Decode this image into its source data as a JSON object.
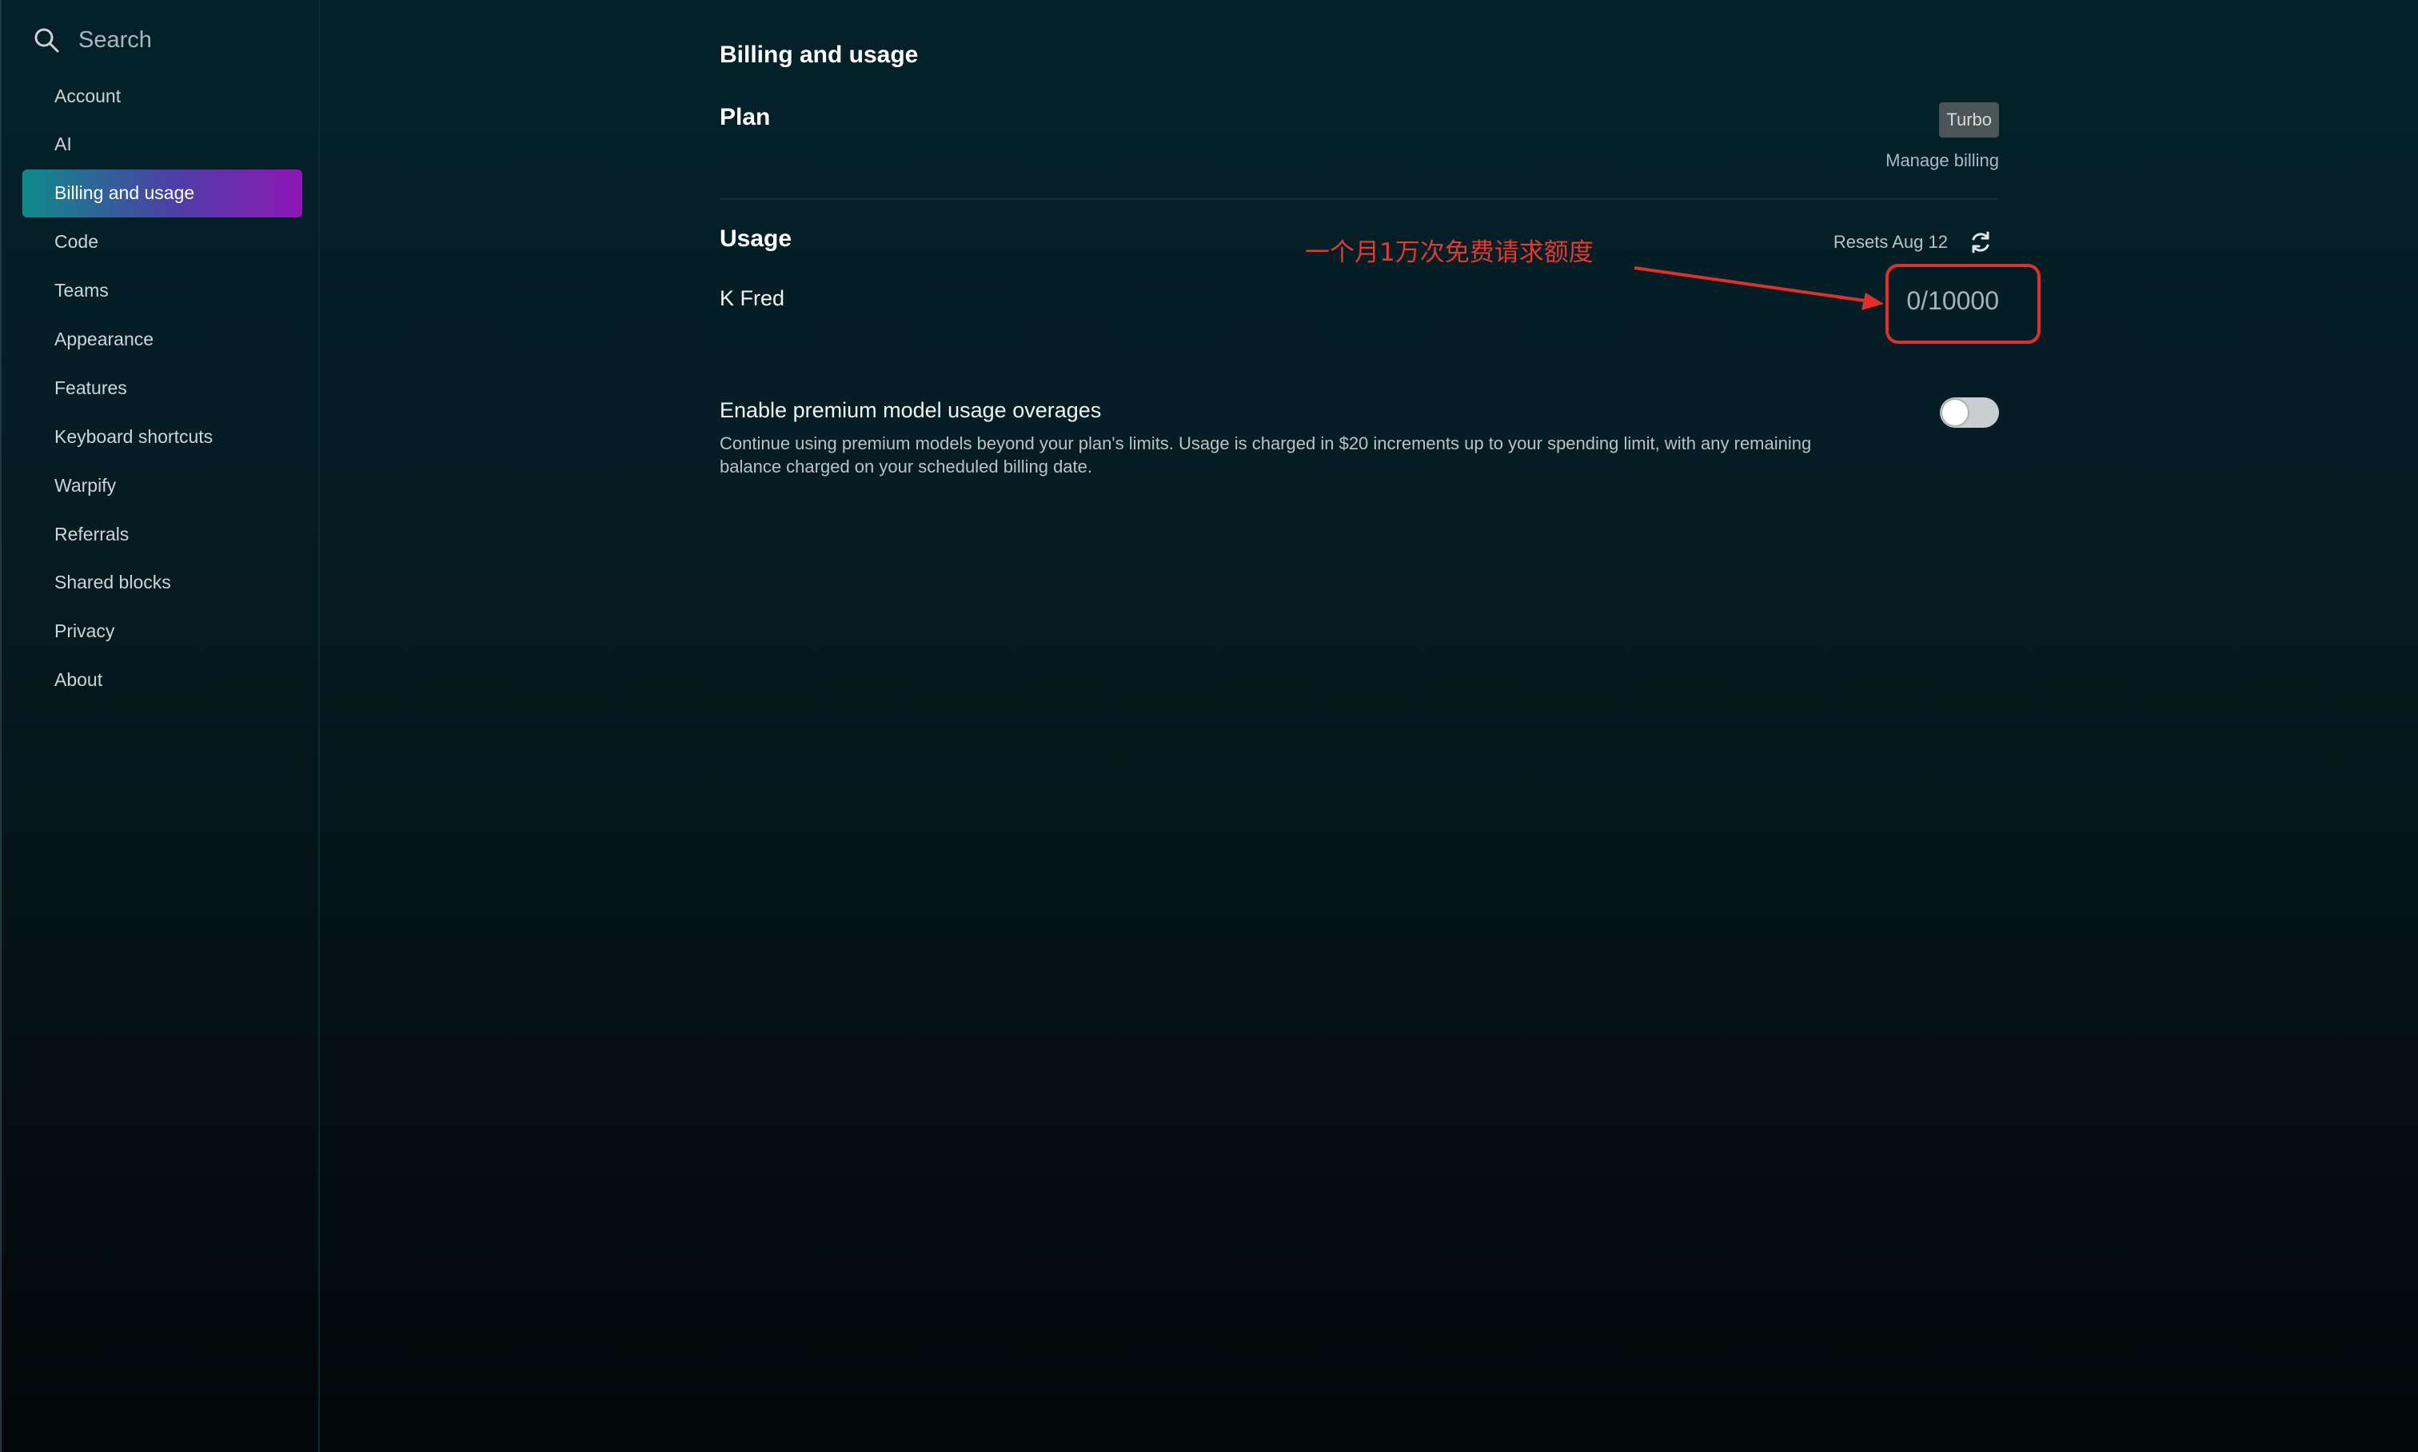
{
  "sidebar": {
    "search_label": "Search",
    "items": [
      {
        "label": "Account"
      },
      {
        "label": "AI"
      },
      {
        "label": "Billing and usage"
      },
      {
        "label": "Code"
      },
      {
        "label": "Teams"
      },
      {
        "label": "Appearance"
      },
      {
        "label": "Features"
      },
      {
        "label": "Keyboard shortcuts"
      },
      {
        "label": "Warpify"
      },
      {
        "label": "Referrals"
      },
      {
        "label": "Shared blocks"
      },
      {
        "label": "Privacy"
      },
      {
        "label": "About"
      }
    ],
    "active_index": 2
  },
  "main": {
    "title": "Billing and usage",
    "plan": {
      "title": "Plan",
      "badge": "Turbo",
      "manage_billing": "Manage billing"
    },
    "usage": {
      "title": "Usage",
      "resets": "Resets Aug 12",
      "user_name": "K Fred",
      "count": "0/10000"
    },
    "overage": {
      "title": "Enable premium model usage overages",
      "description": "Continue using premium models beyond your plan's limits. Usage is charged in $20 increments up to your spending limit, with any remaining balance charged on your scheduled billing date.",
      "enabled": false
    }
  },
  "annotation": {
    "text": "一个月1万次免费请求额度",
    "color": "#e0302c"
  },
  "colors": {
    "accent_gradient_start": "#0f8a8a",
    "accent_gradient_end": "#8e16b7"
  },
  "icons": {
    "search": "search-icon",
    "refresh": "refresh-icon"
  }
}
